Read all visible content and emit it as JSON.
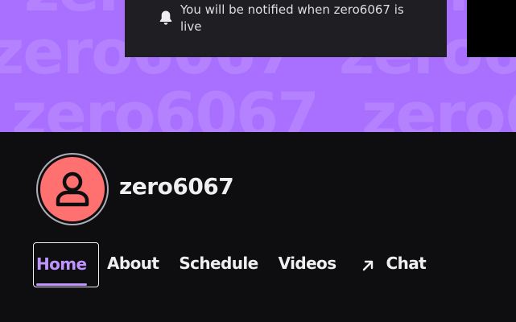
{
  "banner": {
    "watermark_text": "zero6067",
    "background_color": "#a970ff"
  },
  "notification": {
    "icon": "bell-icon",
    "message": "You will be notified when zero6067 is live"
  },
  "channel": {
    "name": "zero6067",
    "avatar_icon": "user-silhouette-icon",
    "avatar_color": "#ff7070"
  },
  "tabs": [
    {
      "label": "Home",
      "active": true
    },
    {
      "label": "About"
    },
    {
      "label": "Schedule"
    },
    {
      "label": "Videos"
    },
    {
      "label": "Chat",
      "icon": "external-arrow-icon"
    }
  ],
  "accent_color": "#bf94ff"
}
